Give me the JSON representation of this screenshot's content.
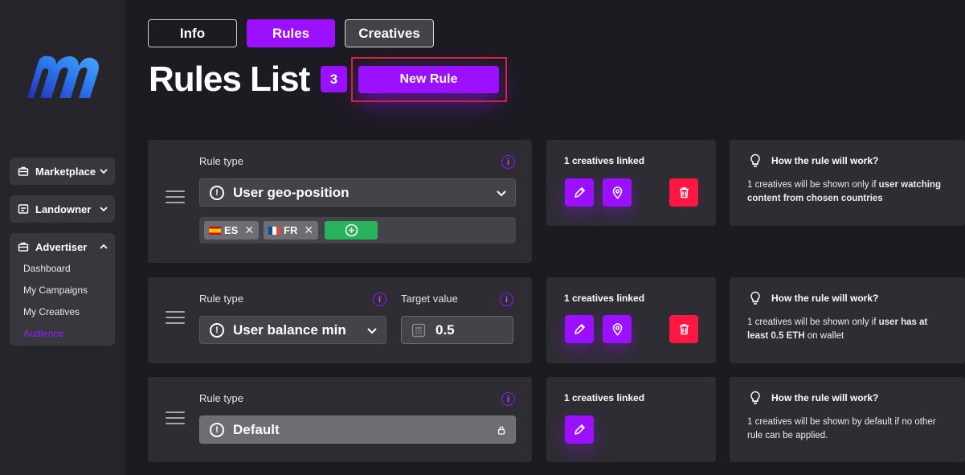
{
  "sidebar": {
    "logo": "m",
    "groups": [
      {
        "label": "Marketplace",
        "icon": "briefcase-icon",
        "expanded": false
      },
      {
        "label": "Landowner",
        "icon": "land-icon",
        "expanded": false
      },
      {
        "label": "Advertiser",
        "icon": "briefcase-icon",
        "expanded": true,
        "items": [
          "Dashboard",
          "My Campaigns",
          "My Creatives",
          "Audience"
        ],
        "active_item": "Audience"
      }
    ]
  },
  "tabs": [
    {
      "label": "Info",
      "active": false
    },
    {
      "label": "Rules",
      "active": true
    },
    {
      "label": "Creatives",
      "active": false
    }
  ],
  "header": {
    "title": "Rules List",
    "count": "3",
    "new_rule_label": "New Rule"
  },
  "rules": [
    {
      "rule_type_label": "Rule type",
      "rule_type_value": "User geo-position",
      "tags": [
        {
          "code": "ES",
          "flag": "spain-flag-icon"
        },
        {
          "code": "FR",
          "flag": "france-flag-icon"
        }
      ],
      "linked": "1 creatives linked",
      "how_title": "How the rule will work?",
      "how_pre": "1 creatives will be shown only if ",
      "how_bold": "user watching content from chosen countries",
      "how_post": ""
    },
    {
      "rule_type_label": "Rule type",
      "rule_type_value": "User balance min",
      "target_label": "Target value",
      "target_value": "0.5",
      "linked": "1 creatives linked",
      "how_title": "How the rule will work?",
      "how_pre": "1 creatives will be shown only if ",
      "how_bold": "user has at least 0.5 ETH",
      "how_post": " on wallet"
    },
    {
      "rule_type_label": "Rule type",
      "rule_type_value": "Default",
      "linked": "1 creatives linked",
      "how_title": "How the rule will work?",
      "how_pre": "1 creatives will be shown by default if no other rule can be applied.",
      "how_bold": "",
      "how_post": ""
    }
  ],
  "colors": {
    "accent": "#9b10ff",
    "delete": "#ff1744",
    "add": "#28b35a",
    "background": "#1d1b22",
    "card": "#2e2d33",
    "highlight": "#e0252a"
  }
}
